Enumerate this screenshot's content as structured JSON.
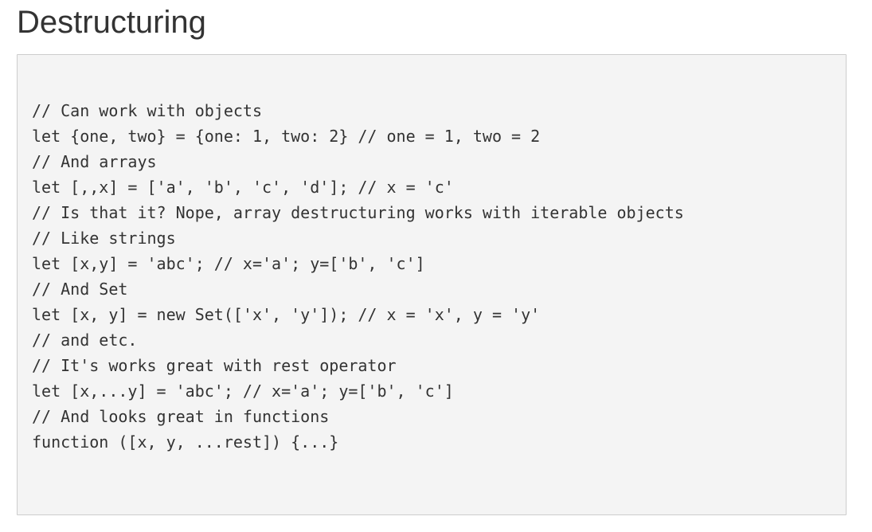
{
  "page": {
    "title": "Destructuring"
  },
  "code": {
    "lines": [
      "// Can work with objects",
      "let {one, two} = {one: 1, two: 2} // one = 1, two = 2",
      "// And arrays",
      "let [,,x] = ['a', 'b', 'c', 'd']; // x = 'c'",
      "// Is that it? Nope, array destructuring works with iterable objects",
      "// Like strings",
      "let [x,y] = 'abc'; // x='a'; y=['b', 'c']",
      "// And Set",
      "let [x, y] = new Set(['x', 'y']); // x = 'x', y = 'y'",
      "// and etc.",
      "// It's works great with rest operator",
      "let [x,...y] = 'abc'; // x='a'; y=['b', 'c']",
      "// And looks great in functions",
      "function ([x, y, ...rest]) {...}"
    ]
  },
  "colors": {
    "text": "#333333",
    "code_background": "#f4f4f4",
    "code_border": "#cccccc"
  }
}
